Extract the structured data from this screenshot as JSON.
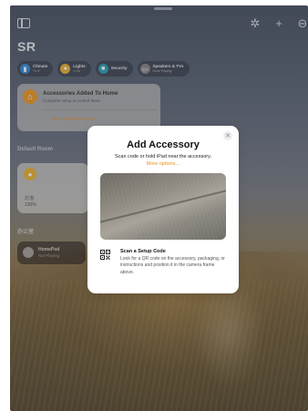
{
  "home": {
    "title": "SR"
  },
  "chips": [
    {
      "name": "climate",
      "label": "Climate",
      "detail": "74.4°",
      "color": "#3b8fd8"
    },
    {
      "name": "lights",
      "label": "Lights",
      "detail": "1 On",
      "color": "#e6b23a"
    },
    {
      "name": "security",
      "label": "Security",
      "detail": "",
      "color": "#2fa3b5"
    },
    {
      "name": "speakers",
      "label": "Speakers & TVs",
      "detail": "None Playing",
      "color": "#8a8a8a"
    }
  ],
  "banner": {
    "title": "Accessories Added To Home",
    "subtitle": "Complete setup to control them.",
    "link": "Set Up Accessories"
  },
  "sections": {
    "default_room": "Default Room",
    "room2": "办公室"
  },
  "bulb_tile": {
    "line1": "灯泡",
    "line2": "100%"
  },
  "homepod_tile": {
    "title": "HomePod",
    "status": "Not Playing"
  },
  "modal": {
    "title": "Add Accessory",
    "subtitle": "Scan code or hold iPad near the accessory.",
    "more": "More options...",
    "scan_title": "Scan a Setup Code",
    "scan_desc": "Look for a QR code on the accessory, packaging, or instructions and position it in the camera frame above.",
    "close_glyph": "✕"
  },
  "colors": {
    "accent": "#e8901f",
    "home_orange": "#e89a2c"
  }
}
